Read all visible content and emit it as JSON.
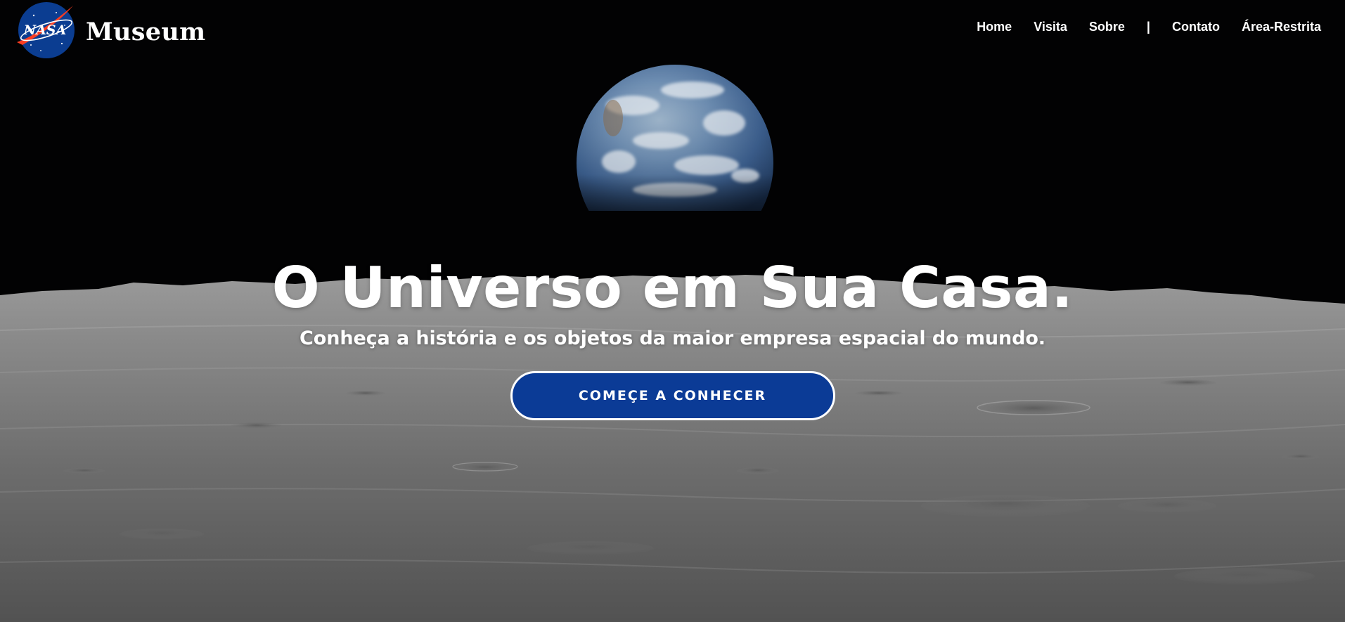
{
  "header": {
    "logo": {
      "emblem_text": "NASA",
      "brand_text": "Museum",
      "icon": "nasa-meatball-icon"
    },
    "nav": [
      {
        "label": "Home"
      },
      {
        "label": "Visita"
      },
      {
        "label": "Sobre"
      },
      {
        "separator": "|"
      },
      {
        "label": "Contato"
      },
      {
        "label": "Área-Restrita"
      }
    ]
  },
  "hero": {
    "title": "O Universo em Sua Casa.",
    "subtitle": "Conheça a história e os objetos da maior empresa espacial do mundo.",
    "cta_label": "COMEÇE A CONHECER"
  },
  "colors": {
    "background_space": "#020203",
    "cta_fill": "#0b3b96",
    "cta_border": "#ffffff",
    "text": "#ffffff",
    "nasa_blue": "#0b3d91",
    "nasa_red": "#fc3d21"
  },
  "background": {
    "image": "earthrise-over-lunar-horizon"
  }
}
